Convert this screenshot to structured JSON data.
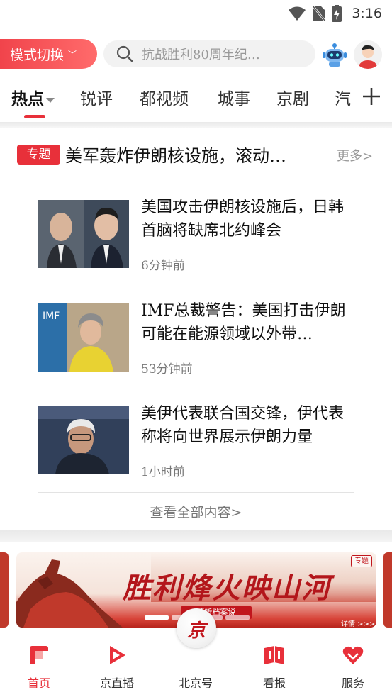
{
  "status_bar": {
    "time": "3:16"
  },
  "header": {
    "mode_switch_label": "模式切换",
    "search_placeholder": "抗战胜利80周年纪…"
  },
  "tabs": [
    {
      "label": "热点",
      "active": true
    },
    {
      "label": "锐评"
    },
    {
      "label": "都视频"
    },
    {
      "label": "城事"
    },
    {
      "label": "京剧"
    },
    {
      "label": "汽"
    }
  ],
  "topic": {
    "badge": "专题",
    "title": "美军轰炸伊朗核设施，滚动…",
    "more_label": "更多>"
  },
  "news": [
    {
      "title": "美国攻击伊朗核设施后，日韩首脑将缺席北约峰会",
      "time": "6分钟前"
    },
    {
      "title": "IMF总裁警告：美国打击伊朗可能在能源领域以外带…",
      "time": "53分钟前"
    },
    {
      "title": "美伊代表联合国交锋，伊代表称将向世界展示伊朗力量",
      "time": "1小时前"
    }
  ],
  "view_all_label": "查看全部内容>",
  "banner": {
    "title": "胜利烽火映山河",
    "subtitle": "请听档案说",
    "tag": "专题",
    "detail_label": "详情 >>>"
  },
  "bottom_nav": [
    {
      "label": "首页",
      "active": true
    },
    {
      "label": "京直播"
    },
    {
      "label": "北京号"
    },
    {
      "label": "看报"
    },
    {
      "label": "服务"
    }
  ],
  "center_button_glyph": "京",
  "colors": {
    "accent": "#e8303a",
    "text": "#111111",
    "muted": "#777777"
  }
}
